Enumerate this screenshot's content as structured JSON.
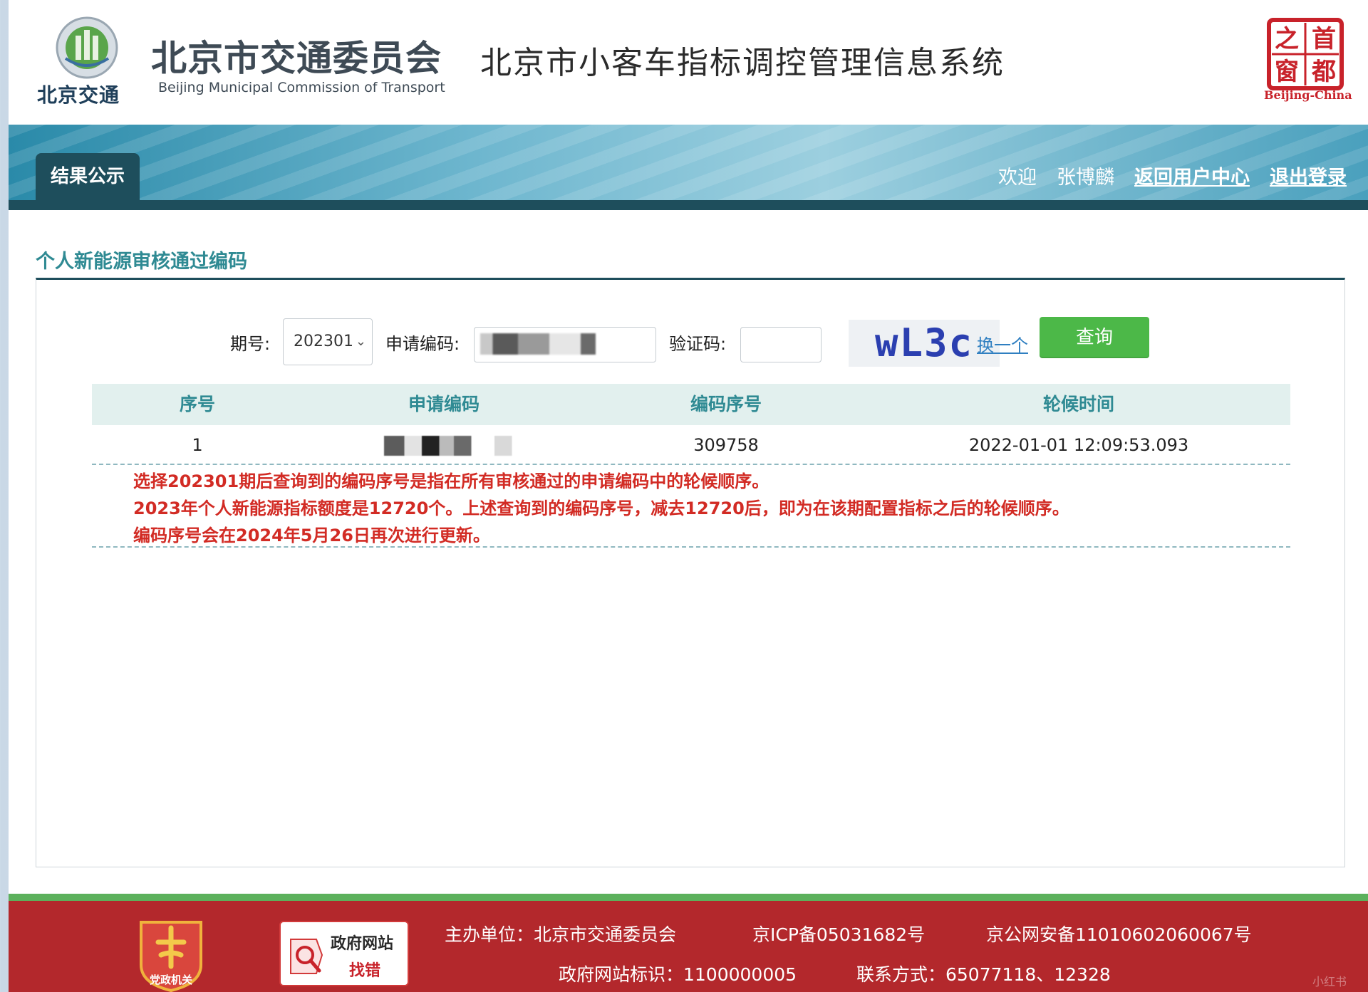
{
  "header": {
    "logo_brand": "北京交通",
    "org_name_cn": "北京市交通委员会",
    "org_name_en": "Beijing Municipal Commission of Transport",
    "system_title": "北京市小客车指标调控管理信息系统",
    "seal_chars": [
      "之",
      "首",
      "窗",
      "都"
    ],
    "seal_en": "Beijing-China"
  },
  "nav": {
    "active_tab": "结果公示",
    "welcome": "欢迎",
    "user_name": "张博麟",
    "back_link": "返回用户中心",
    "logout_link": "退出登录"
  },
  "section": {
    "title": "个人新能源审核通过编码"
  },
  "query": {
    "period_label": "期号:",
    "period_value": "202301",
    "code_label": "申请编码:",
    "captcha_label": "验证码:",
    "captcha_value": "",
    "captcha_text": "wL3c",
    "refresh_label": "换一个",
    "submit_label": "查询"
  },
  "table": {
    "columns": [
      "序号",
      "申请编码",
      "编码序号",
      "轮候时间"
    ],
    "rows": [
      {
        "index": "1",
        "code": "",
        "seq": "309758",
        "time": "2022-01-01 12:09:53.093"
      }
    ]
  },
  "notes": [
    "选择202301期后查询到的编码序号是指在所有审核通过的申请编码中的轮候顺序。",
    "2023年个人新能源指标额度是12720个。上述查询到的编码序号，减去12720后，即为在该期配置指标之后的轮候顺序。",
    "编码序号会在2024年5月26日再次进行更新。"
  ],
  "footer": {
    "party_badge": "党政机关",
    "gov_box_line1": "政府网站",
    "gov_box_line2": "找错",
    "sponsor": "主办单位：北京市交通委员会",
    "icp": "京ICP备05031682号",
    "police": "京公网安备11010602060067号",
    "site_id": "政府网站标识：1100000005",
    "contact": "联系方式：65077118、12328",
    "watermark": "小红书"
  },
  "colors": {
    "nav_dark": "#1e4e5c",
    "teal_text": "#2f8a93",
    "note_red": "#d22b24",
    "query_green": "#4cb848",
    "footer_red": "#b3282c",
    "footer_green": "#5cb15c"
  }
}
